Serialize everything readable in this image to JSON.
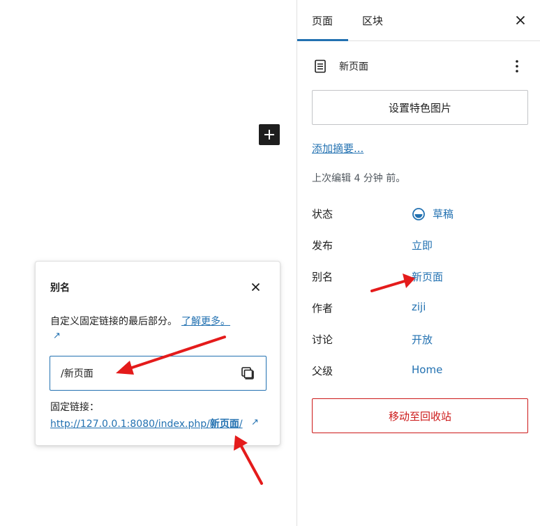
{
  "sidebar": {
    "tabs": [
      {
        "label": "页面",
        "active": true
      },
      {
        "label": "区块",
        "active": false
      }
    ],
    "document_title": "新页面",
    "featured_image_label": "设置特色图片",
    "excerpt_link": "添加摘要...",
    "last_edited": "上次编辑 4 分钟 前。",
    "meta": {
      "status_label": "状态",
      "status_value": "草稿",
      "publish_label": "发布",
      "publish_value": "立即",
      "slug_label": "别名",
      "slug_value": "新页面",
      "author_label": "作者",
      "author_value": "ziji",
      "discussion_label": "讨论",
      "discussion_value": "开放",
      "parent_label": "父级",
      "parent_value": "Home"
    },
    "trash_label": "移动至回收站"
  },
  "popover": {
    "title": "别名",
    "description": "自定义固定链接的最后部分。",
    "learn_more": "了解更多。",
    "external_glyph": "↗",
    "slug_input_value": "/新页面",
    "permalink_label": "固定链接：",
    "permalink_prefix": "http://127.0.0.1:8080/index.php/",
    "permalink_slug": "新页面",
    "permalink_suffix": "/"
  },
  "colors": {
    "accent": "#2271b1",
    "danger": "#cc1818",
    "annotation": "#e41b1b",
    "text": "#1e1e1e"
  },
  "icons": {
    "inserter": "plus-icon",
    "close": "close-icon",
    "document": "page-icon",
    "more": "more-vertical-icon",
    "status": "draft-status-icon",
    "copy": "copy-icon",
    "external": "external-link-icon"
  }
}
